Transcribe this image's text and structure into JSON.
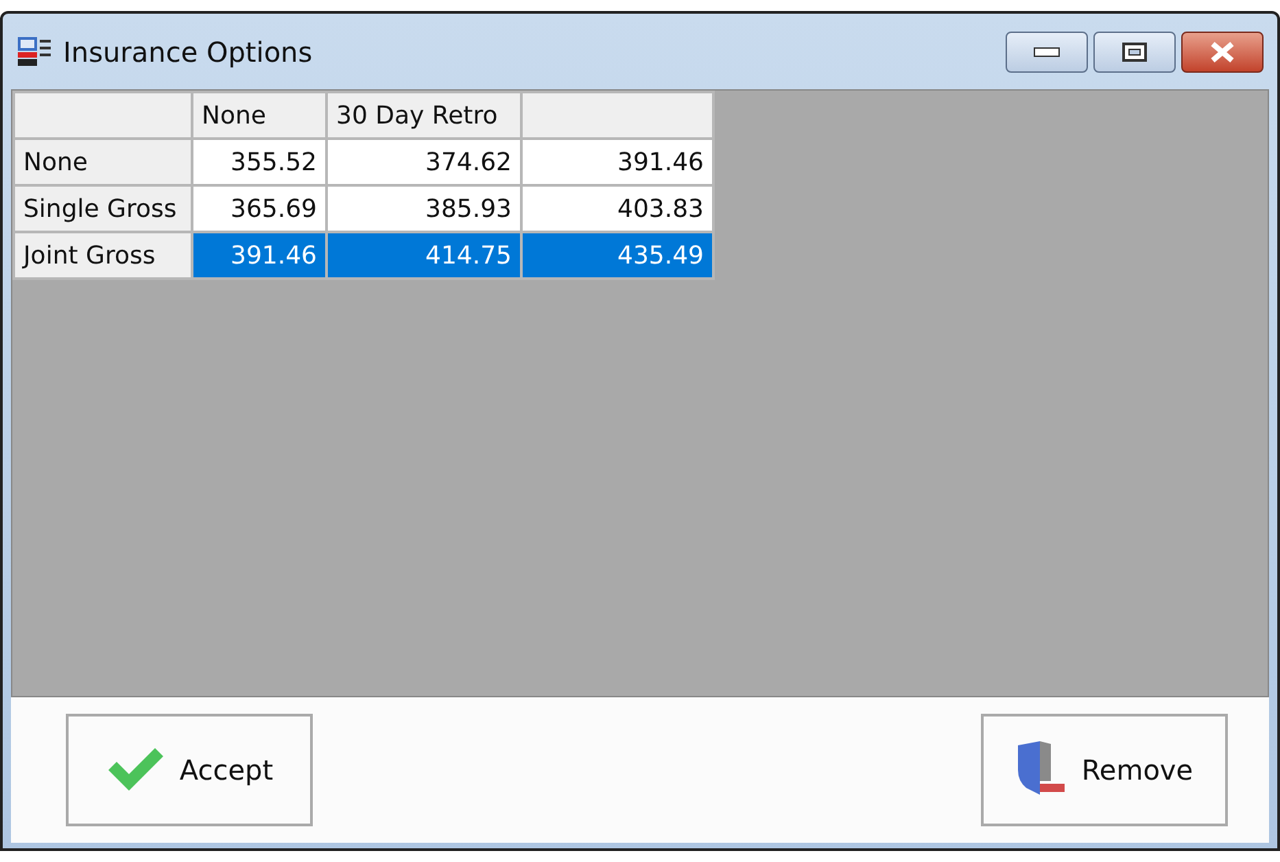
{
  "window": {
    "title": "Insurance Options"
  },
  "grid": {
    "columns": [
      "None",
      "30 Day Retro"
    ],
    "rows": [
      {
        "label": "None",
        "selected": false,
        "values": [
          "355.52",
          "374.62",
          "391.46"
        ]
      },
      {
        "label": "Single Gross",
        "selected": false,
        "values": [
          "365.69",
          "385.93",
          "403.83"
        ]
      },
      {
        "label": "Joint Gross",
        "selected": true,
        "values": [
          "391.46",
          "414.75",
          "435.49"
        ]
      }
    ]
  },
  "buttons": [
    {
      "label": "Accept",
      "kind": "accept"
    },
    {
      "label": "Remove",
      "kind": "remove"
    }
  ]
}
